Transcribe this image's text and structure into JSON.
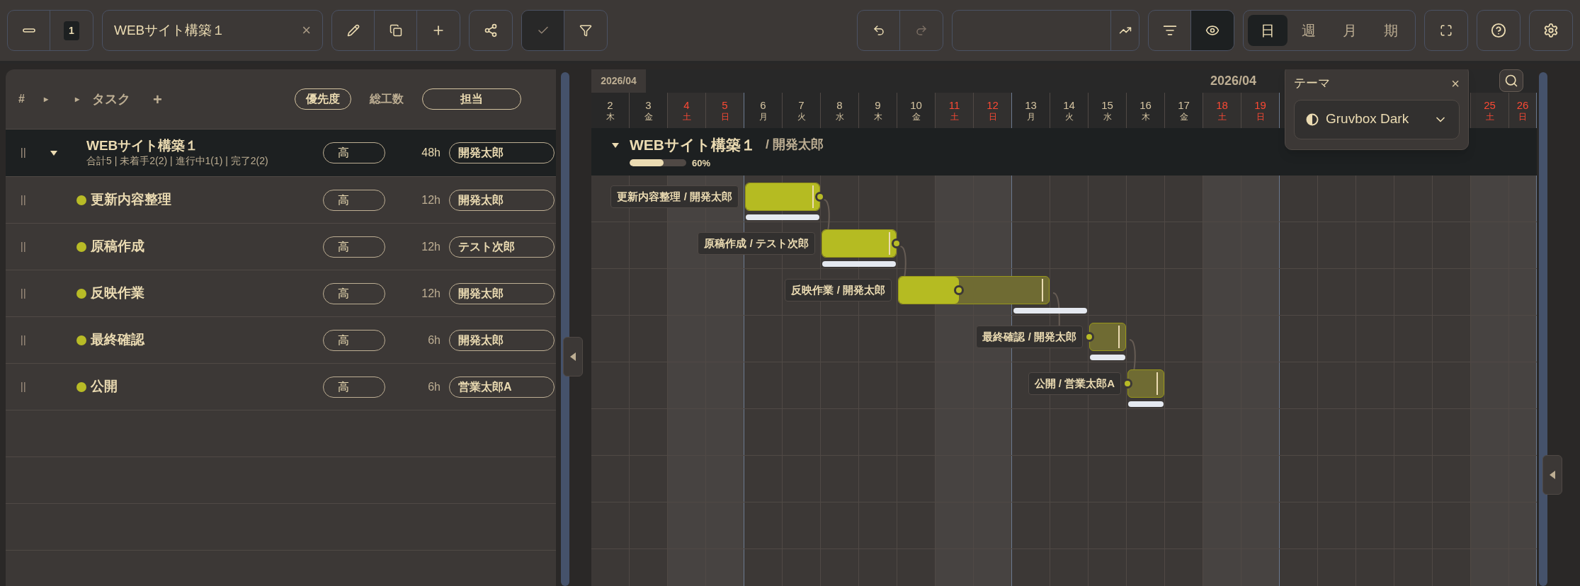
{
  "toolbar": {
    "level_badge": "1",
    "project_field": {
      "value": "WEBサイト構築１",
      "clear": "×"
    },
    "check_toggle": {
      "on": true
    },
    "undo": {
      "disabled": false
    },
    "redo": {
      "disabled": true
    },
    "eye_toggle": {
      "on": true
    },
    "view_tabs": [
      {
        "label": "日",
        "selected": true
      },
      {
        "label": "週",
        "selected": false
      },
      {
        "label": "月",
        "selected": false
      },
      {
        "label": "期",
        "selected": false
      }
    ]
  },
  "task_table": {
    "columns": [
      "#",
      "▸",
      "▸",
      "タスク",
      "+",
      "優先度",
      "総工数",
      "担当"
    ],
    "project": {
      "name": "WEBサイト構築１",
      "summary": "合計5 | 未着手2(2) | 進行中1(1) | 完了2(2)",
      "priority": "高",
      "hours": "48h",
      "assignee": "開発太郎",
      "expanded": true
    },
    "tasks": [
      {
        "name": "更新内容整理",
        "priority": "高",
        "hours": "12h",
        "assignee": "開発太郎"
      },
      {
        "name": "原稿作成",
        "priority": "高",
        "hours": "12h",
        "assignee": "テスト次郎"
      },
      {
        "name": "反映作業",
        "priority": "高",
        "hours": "12h",
        "assignee": "開発太郎"
      },
      {
        "name": "最終確認",
        "priority": "高",
        "hours": "6h",
        "assignee": "開発太郎"
      },
      {
        "name": "公開",
        "priority": "高",
        "hours": "6h",
        "assignee": "営業太郎A"
      }
    ]
  },
  "timeline": {
    "month_left": "2026/04",
    "month_center": "2026/04",
    "days": [
      {
        "day": "2",
        "weekday": "木",
        "weekend": false
      },
      {
        "day": "3",
        "weekday": "金",
        "weekend": false
      },
      {
        "day": "4",
        "weekday": "土",
        "weekend": true
      },
      {
        "day": "5",
        "weekday": "日",
        "weekend": true
      },
      {
        "day": "6",
        "weekday": "月",
        "weekend": false
      },
      {
        "day": "7",
        "weekday": "火",
        "weekend": false
      },
      {
        "day": "8",
        "weekday": "水",
        "weekend": false
      },
      {
        "day": "9",
        "weekday": "木",
        "weekend": false
      },
      {
        "day": "10",
        "weekday": "金",
        "weekend": false
      },
      {
        "day": "11",
        "weekday": "土",
        "weekend": true
      },
      {
        "day": "12",
        "weekday": "日",
        "weekend": true
      },
      {
        "day": "13",
        "weekday": "月",
        "weekend": false
      },
      {
        "day": "14",
        "weekday": "火",
        "weekend": false
      },
      {
        "day": "15",
        "weekday": "水",
        "weekend": false
      },
      {
        "day": "16",
        "weekday": "木",
        "weekend": false
      },
      {
        "day": "17",
        "weekday": "金",
        "weekend": false
      },
      {
        "day": "18",
        "weekday": "土",
        "weekend": true
      },
      {
        "day": "19",
        "weekday": "日",
        "weekend": true
      }
    ],
    "days_after_popup": [
      {
        "day": "25",
        "weekday": "土",
        "weekend": true
      },
      {
        "day": "26",
        "weekday": "日",
        "weekend": true
      }
    ]
  },
  "project_bar": {
    "name": "WEBサイト構築１",
    "owner": "/ 開発太郎",
    "level": 0.6,
    "reading": "60%",
    "expanded": true
  },
  "bars": [
    {
      "label": "更新内容整理 / 開発太郎",
      "level": 1
    },
    {
      "label": "原稿作成 / テスト次郎",
      "level": 1
    },
    {
      "label": "反映作業 / 開発太郎",
      "level": 0.4
    },
    {
      "label": "最終確認 / 開発太郎",
      "level": 0
    },
    {
      "label": "公開 / 営業太郎A",
      "level": 0
    }
  ],
  "theme_popup": {
    "title": "テーマ",
    "close": "×",
    "value": "Gruvbox Dark"
  }
}
